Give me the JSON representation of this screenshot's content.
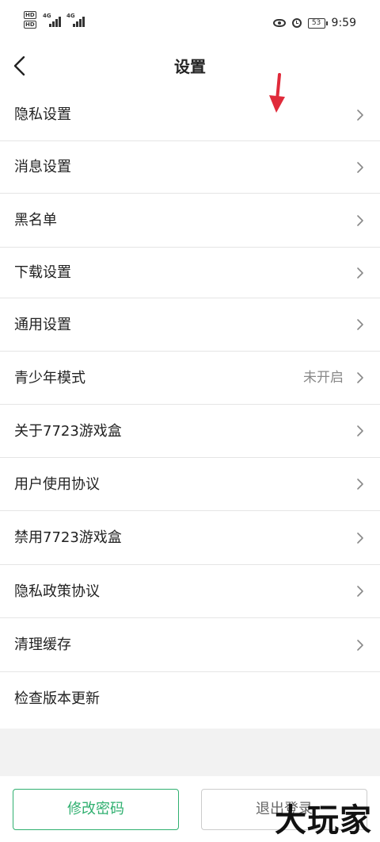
{
  "status_bar": {
    "hd1": "HD",
    "hd2": "HD",
    "net1": "4G",
    "net2": "4G",
    "battery": "53",
    "time": "9:59"
  },
  "header": {
    "title": "设置"
  },
  "settings": [
    {
      "label": "隐私设置",
      "value": ""
    },
    {
      "label": "消息设置",
      "value": ""
    },
    {
      "label": "黑名单",
      "value": ""
    },
    {
      "label": "下载设置",
      "value": ""
    },
    {
      "label": "通用设置",
      "value": ""
    },
    {
      "label": "青少年模式",
      "value": "未开启"
    },
    {
      "label": "关于7723游戏盒",
      "value": ""
    },
    {
      "label": "用户使用协议",
      "value": ""
    },
    {
      "label": "禁用7723游戏盒",
      "value": ""
    },
    {
      "label": "隐私政策协议",
      "value": ""
    },
    {
      "label": "清理缓存",
      "value": ""
    },
    {
      "label": "检查版本更新",
      "value": ""
    }
  ],
  "footer": {
    "change_password": "修改密码",
    "logout": "退出登录"
  },
  "watermark": "大玩家",
  "colors": {
    "accent": "#30b070",
    "annotation": "#e02a3a"
  },
  "icons": [
    "back-arrow-icon",
    "chevron-right-icon",
    "eye-icon",
    "alarm-icon",
    "battery-icon",
    "signal-icon"
  ]
}
